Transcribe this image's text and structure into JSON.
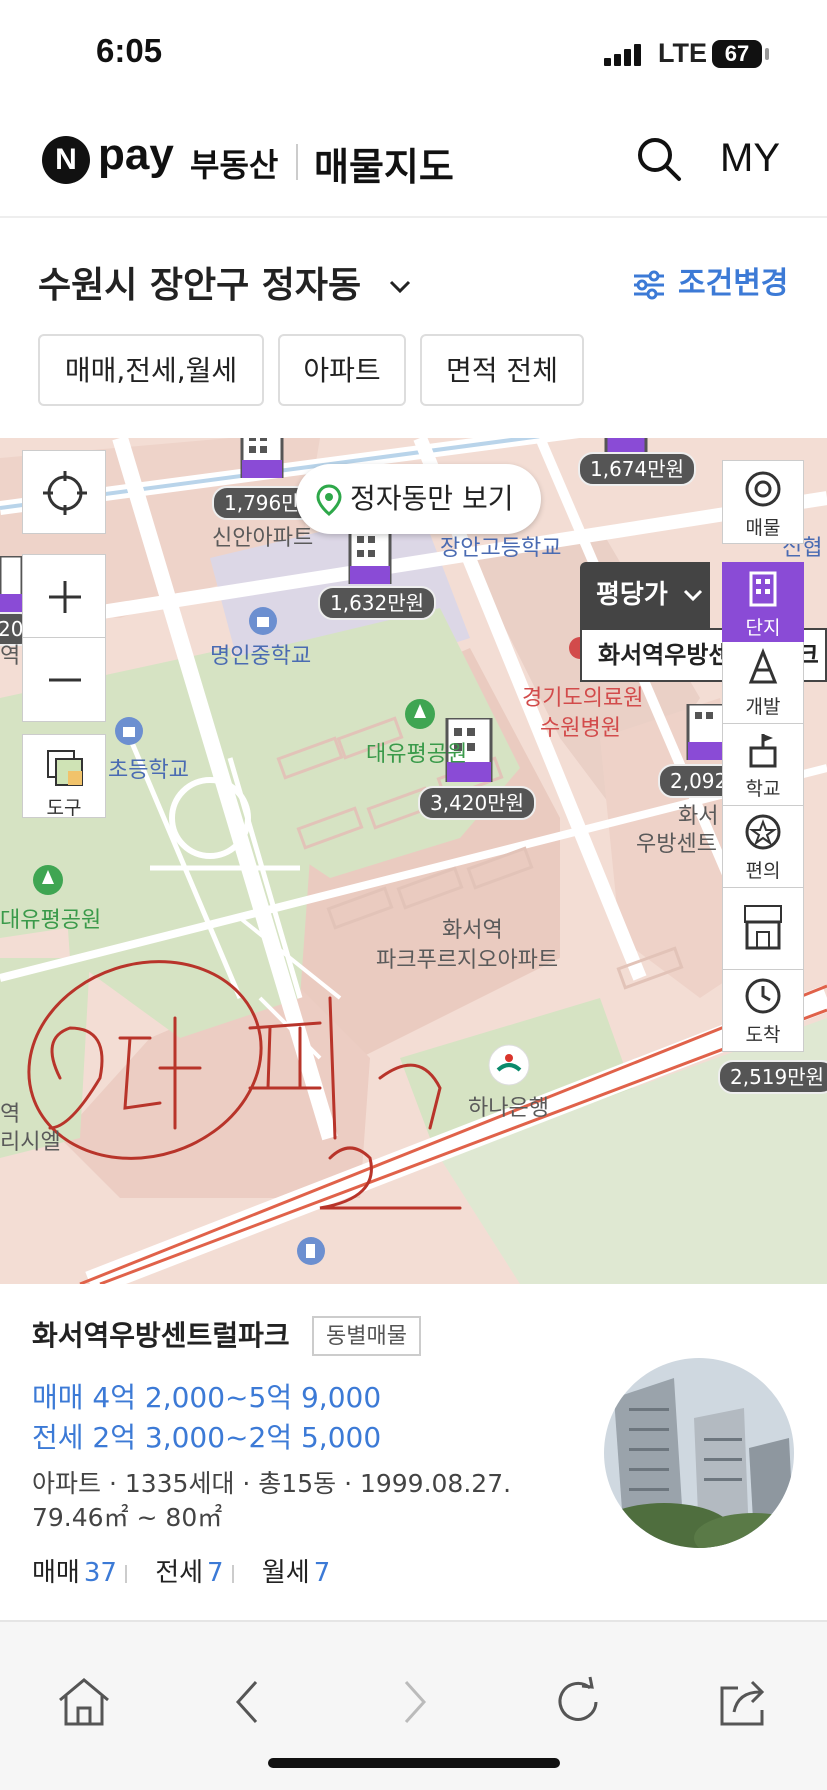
{
  "status_bar": {
    "time": "6:05",
    "network": "LTE",
    "battery": "67"
  },
  "header": {
    "logo_n": "N",
    "logo_pay": "pay",
    "logo_sub": "부동산",
    "title": "매물지도",
    "search_icon": "search-icon",
    "my_label": "MY"
  },
  "location": {
    "label": "수원시 장안구 정자동",
    "condition_label": "조건변경"
  },
  "filters": [
    "매매,전세,월세",
    "아파트",
    "면적 전체"
  ],
  "map": {
    "view_only_label": "정자동만 보기",
    "ppa_tab_label": "평당가",
    "selected_complex_label": "화서역우방센트럴파크",
    "left_controls": {
      "tool_label": "도구"
    },
    "right_controls": [
      "매물",
      "단지",
      "개발",
      "학교",
      "편의",
      "중개",
      "도착"
    ],
    "price_markers": [
      "1,796만원",
      "1,674만원",
      "1,632만원",
      "2,092",
      "3,420만원",
      "2,519만원",
      "20"
    ],
    "labels": {
      "sinan": "신안아파트",
      "janganhs": "장안고등학교",
      "shinhyeop": "신협",
      "myeongin": "명인중학교",
      "daeyupark1": "대유평공원",
      "daeyupark2": "대유평공원",
      "elem": "초등학교",
      "hospital1": "경기도의료원",
      "hospital2": "수원병원",
      "hwaseo1": "화서역",
      "hwaseo2": "파크푸르지오아파트",
      "hwaseo_side1": "화서",
      "hwaseo_side2": "우방센트",
      "hana": "하나은행",
      "left_cut1": "역",
      "left_cut2": "리시엘",
      "left_cut3": "역"
    },
    "annotation": "handwritten scribble"
  },
  "complex_card": {
    "name": "화서역우방센트럴파크",
    "tag": "동별매물",
    "sale_range": "매매 4억 2,000~5억 9,000",
    "jeonse_range": "전세 2억 3,000~2억 5,000",
    "info": "아파트 · 1335세대 · 총15동 · 1999.08.27.",
    "area": "79.46㎡ ~ 80㎡",
    "counts": [
      {
        "label": "매매",
        "value": "37"
      },
      {
        "label": "전세",
        "value": "7"
      },
      {
        "label": "월세",
        "value": "7"
      }
    ]
  },
  "browser_bar": [
    "home-icon",
    "back-icon",
    "forward-icon",
    "reload-icon",
    "share-icon"
  ],
  "colors": {
    "accent_blue": "#3c7ad6",
    "active_purple": "#8a4bd6",
    "map_bg": "#f3ddd4"
  }
}
